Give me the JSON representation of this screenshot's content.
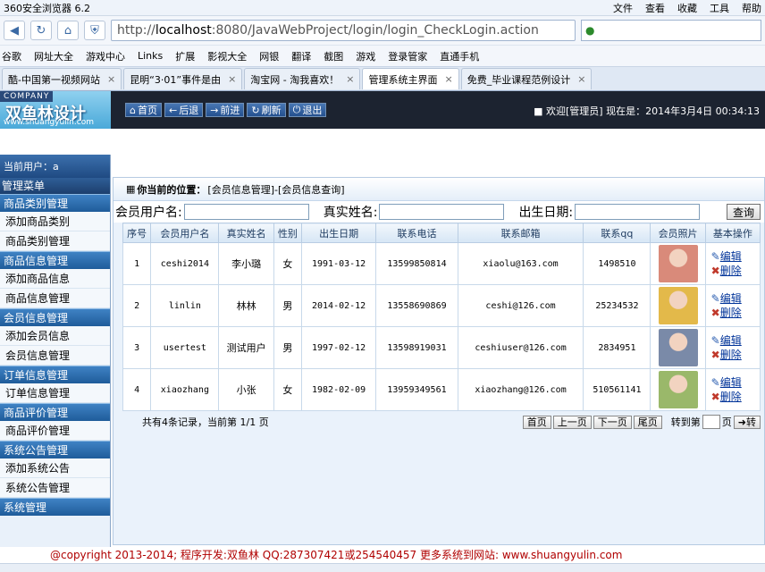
{
  "browser": {
    "title": "360安全浏览器 6.2",
    "menus": [
      "文件",
      "查看",
      "收藏",
      "工具",
      "帮助"
    ],
    "url_prefix": "http://",
    "url_host": "localhost",
    "url_rest": ":8080/JavaWebProject/login/login_CheckLogin.action",
    "bookmarks": [
      "谷歌",
      "网址大全",
      "游戏中心",
      "Links",
      "扩展",
      "影视大全",
      "网银",
      "翻译",
      "截图",
      "游戏",
      "登录管家",
      "直通手机"
    ],
    "tabs": [
      {
        "label": "酷-中国第一视频网站",
        "active": false
      },
      {
        "label": "昆明“3·01”事件是由",
        "active": false
      },
      {
        "label": "淘宝网 - 淘我喜欢！",
        "active": false
      },
      {
        "label": "管理系统主界面",
        "active": true
      },
      {
        "label": "免费_毕业课程范例设计",
        "active": false
      }
    ]
  },
  "app": {
    "company": "COMPANY",
    "logo_name": "双鱼林设计",
    "logo_site": "www.shuangyulin.com",
    "topnav": [
      {
        "label": "首页",
        "icon": "home-icon"
      },
      {
        "label": "后退",
        "icon": "back-icon"
      },
      {
        "label": "前进",
        "icon": "forward-icon"
      },
      {
        "label": "刷新",
        "icon": "refresh-icon"
      },
      {
        "label": "退出",
        "icon": "power-icon"
      }
    ],
    "welcome": "欢迎[管理员]",
    "now": "现在是：2014年3月4日  00:34:13"
  },
  "sidebar": {
    "current_user": "当前用户：a",
    "menu_title": "管理菜单",
    "groups": [
      {
        "title": "商品类别管理",
        "items": [
          "添加商品类别",
          "商品类别管理"
        ]
      },
      {
        "title": "商品信息管理",
        "items": [
          "添加商品信息",
          "商品信息管理"
        ]
      },
      {
        "title": "会员信息管理",
        "items": [
          "添加会员信息",
          "会员信息管理"
        ]
      },
      {
        "title": "订单信息管理",
        "items": [
          "订单信息管理"
        ]
      },
      {
        "title": "商品评价管理",
        "items": [
          "商品评价管理"
        ]
      },
      {
        "title": "系统公告管理",
        "items": [
          "添加系统公告",
          "系统公告管理"
        ]
      },
      {
        "title": "系统管理",
        "items": []
      }
    ]
  },
  "main": {
    "location_label": "你当前的位置：",
    "location": "[会员信息管理]-[会员信息查询]",
    "search": {
      "user_label": "会员用户名:",
      "name_label": "真实姓名:",
      "birth_label": "出生日期:",
      "button": "查询"
    },
    "columns": [
      "序号",
      "会员用户名",
      "真实姓名",
      "性别",
      "出生日期",
      "联系电话",
      "联系邮箱",
      "联系qq",
      "会员照片",
      "基本操作"
    ],
    "rows": [
      {
        "no": "1",
        "user": "ceshi2014",
        "name": "李小璐",
        "sex": "女",
        "birth": "1991-03-12",
        "phone": "13599850814",
        "email": "xiaolu@163.com",
        "qq": "1498510",
        "photo_color": "#d98a7a"
      },
      {
        "no": "2",
        "user": "linlin",
        "name": "林林",
        "sex": "男",
        "birth": "2014-02-12",
        "phone": "13558690869",
        "email": "ceshi@126.com",
        "qq": "25234532",
        "photo_color": "#e3b94a"
      },
      {
        "no": "3",
        "user": "usertest",
        "name": "测试用户",
        "sex": "男",
        "birth": "1997-02-12",
        "phone": "13598919031",
        "email": "ceshiuser@126.com",
        "qq": "2834951",
        "photo_color": "#7a8aa8"
      },
      {
        "no": "4",
        "user": "xiaozhang",
        "name": "小张",
        "sex": "女",
        "birth": "1982-02-09",
        "phone": "13959349561",
        "email": "xiaozhang@126.com",
        "qq": "510561141",
        "photo_color": "#9ab86a"
      }
    ],
    "edit_label": "编辑",
    "delete_label": "删除",
    "pager": {
      "summary": "共有4条记录，当前第 1/1 页",
      "first": "首页",
      "prev": "上一页",
      "next": "下一页",
      "last": "尾页",
      "goto_label": "转到第",
      "page_unit": "页",
      "goto_btn": "转"
    }
  },
  "footer": "@copyright 2013-2014; 程序开发:双鱼林  QQ:287307421或254540457  更多系统到网站: www.shuangyulin.com"
}
